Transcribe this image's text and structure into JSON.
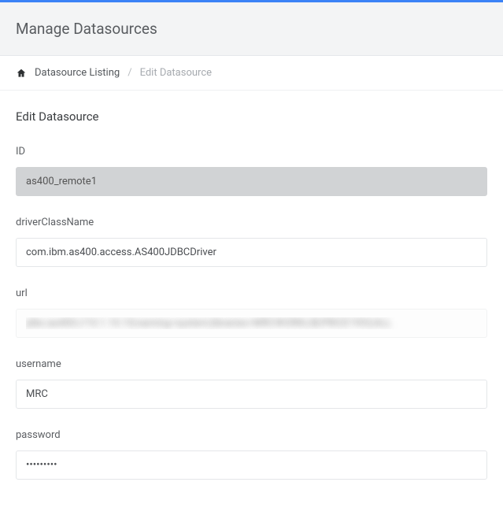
{
  "header": {
    "title": "Manage Datasources"
  },
  "breadcrumb": {
    "listing_label": "Datasource Listing",
    "separator": "/",
    "current_label": "Edit Datasource"
  },
  "form": {
    "section_title": "Edit Datasource",
    "fields": {
      "id": {
        "label": "ID",
        "value": "as400_remote1"
      },
      "driverClassName": {
        "label": "driverClassName",
        "value": "com.ibm.as400.access.AS400JDBCDriver"
      },
      "url": {
        "label": "url",
        "value": "jdbc:as400://10.1.10.10;naming=system;libraries=MRCWORKLIB;PRICE1953;ALL"
      },
      "username": {
        "label": "username",
        "value": "MRC"
      },
      "password": {
        "label": "password",
        "value": "•••••••••"
      }
    }
  }
}
